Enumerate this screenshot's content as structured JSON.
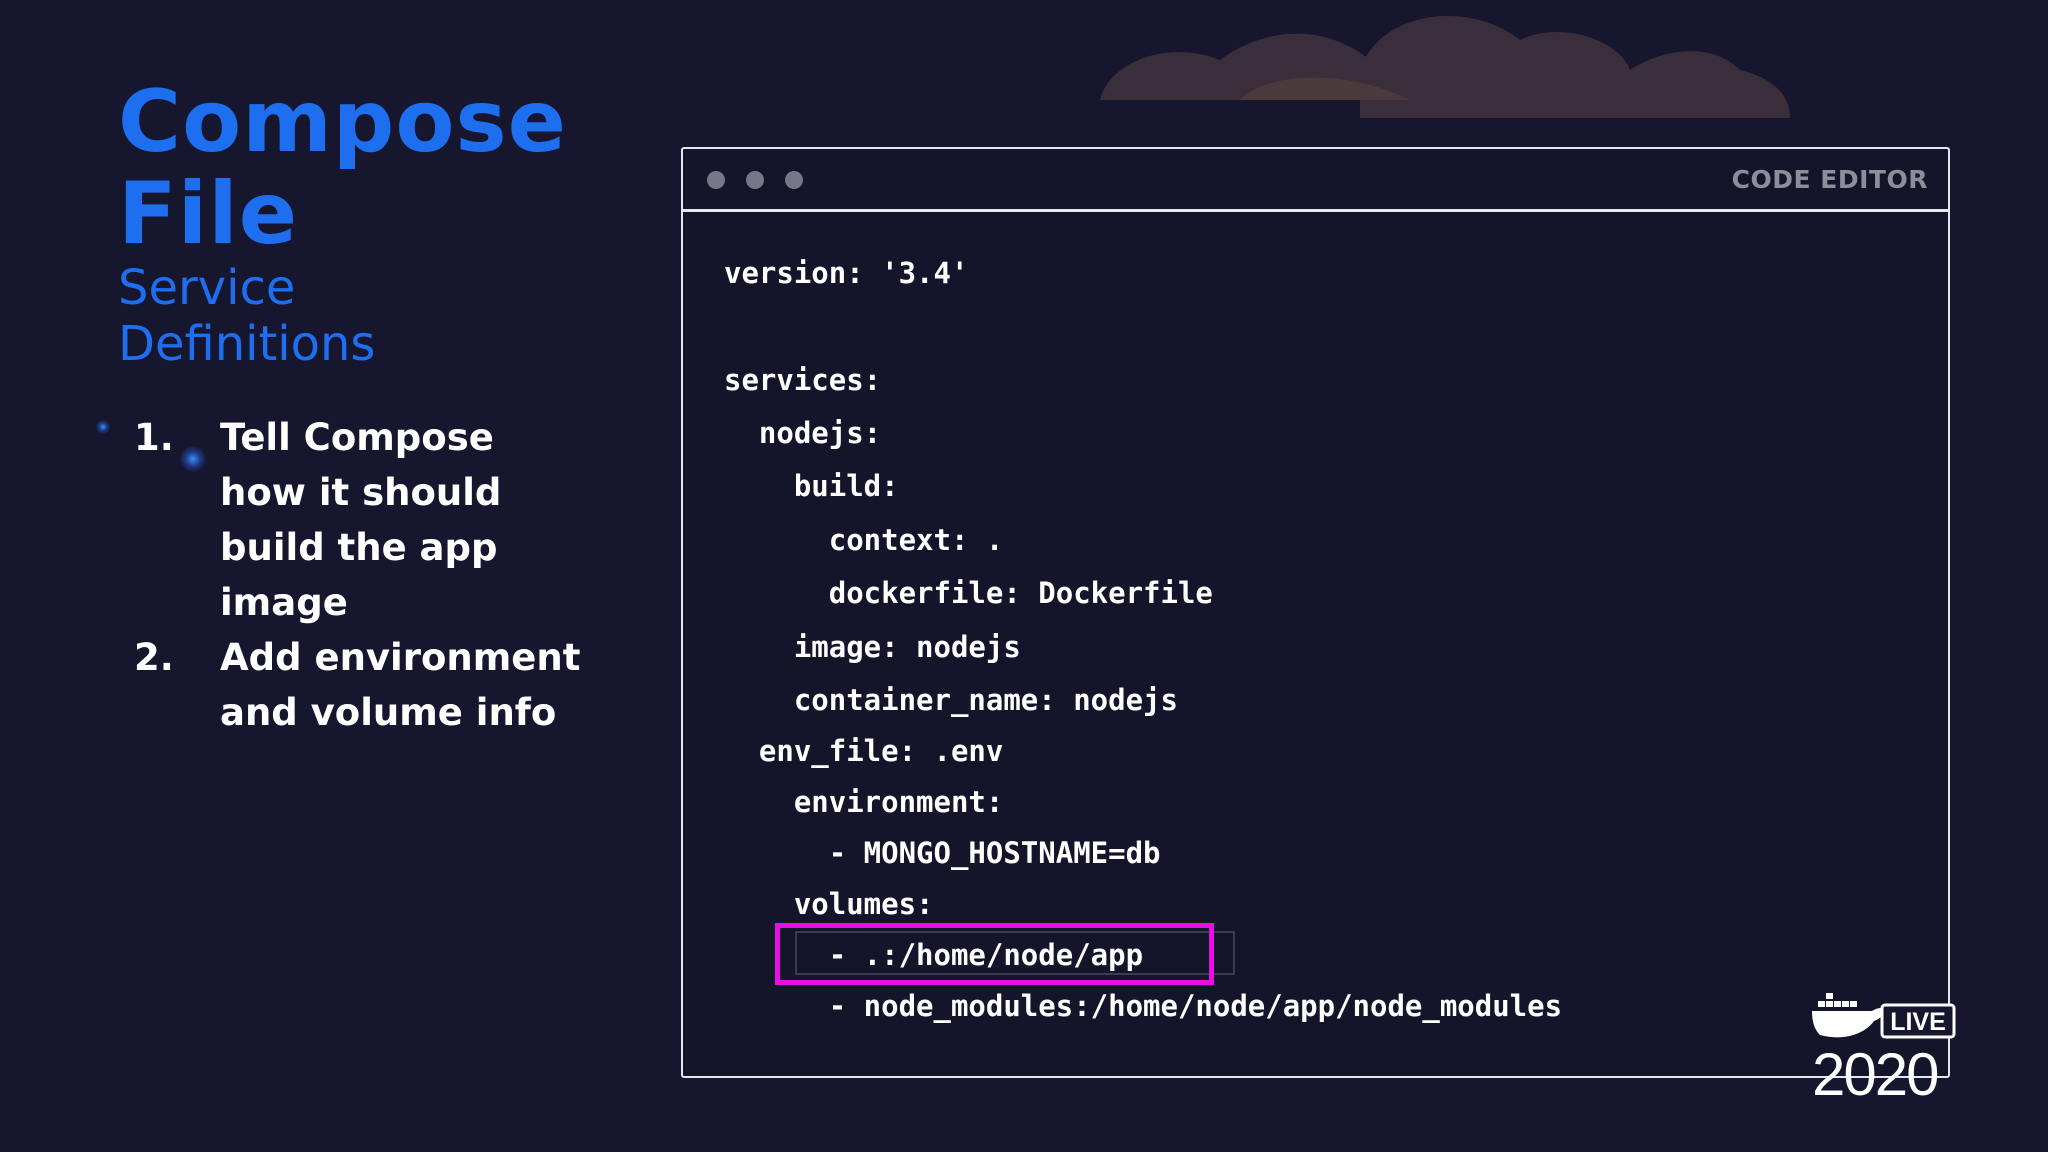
{
  "slide": {
    "title_line1": "Compose",
    "title_line2": "File",
    "subtitle_line1": "Service",
    "subtitle_line2": "Definitions",
    "list": [
      {
        "num": "1.",
        "lines": [
          "Tell Compose",
          "how it should",
          "build the app",
          "image"
        ]
      },
      {
        "num": "2.",
        "lines": [
          "Add environment",
          "and volume info"
        ]
      }
    ]
  },
  "editor": {
    "label": "CODE EDITOR",
    "lines": [
      "version: '3.4'",
      "services:",
      "  nodejs:",
      "    build:",
      "      context: .",
      "      dockerfile: Dockerfile",
      "    image: nodejs",
      "    container_name: nodejs",
      "  env_file: .env",
      "    environment:",
      "      - MONGO_HOSTNAME=db",
      "    volumes:",
      "      - .:/home/node/app",
      "      - node_modules:/home/node/app/node_modules"
    ]
  },
  "logo": {
    "badge": "LIVE",
    "year": "2020"
  },
  "colors": {
    "background": "#16162f",
    "accent_blue": "#1d6ff0",
    "highlight_magenta": "#e80fe6",
    "cloud_brown": "#3a2f3a"
  }
}
